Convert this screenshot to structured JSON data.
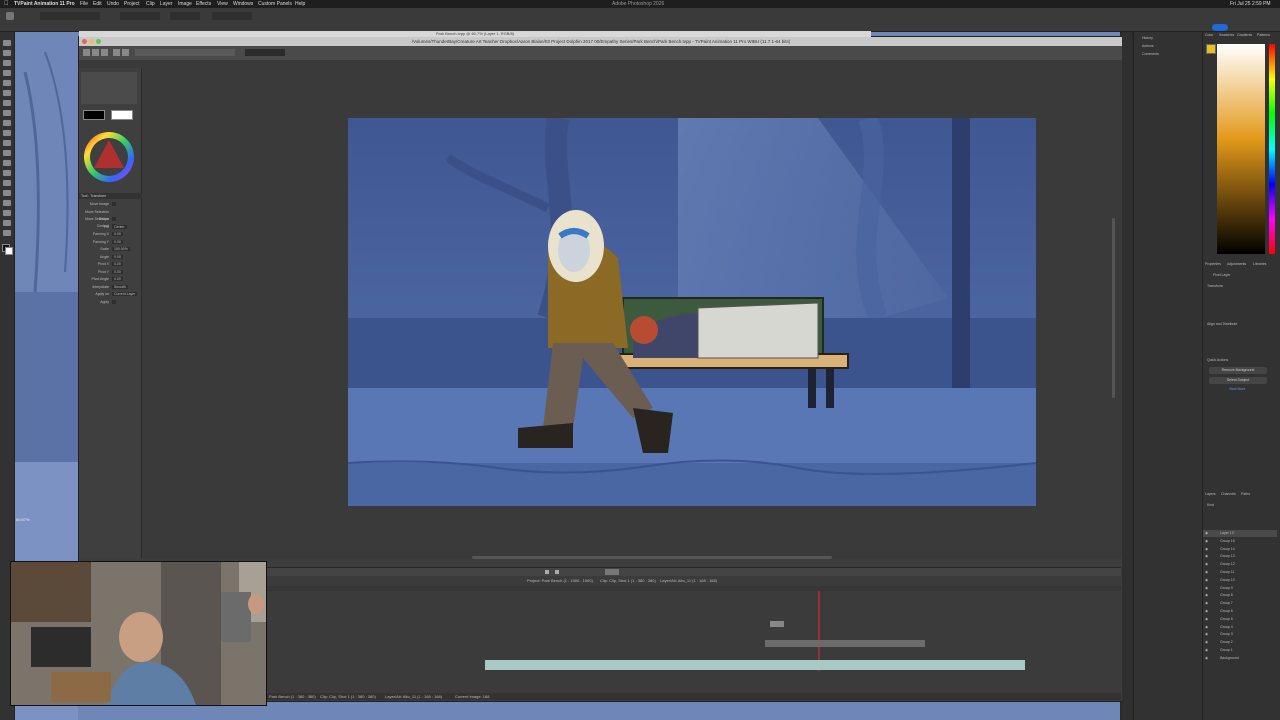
{
  "menubar": {
    "app_name": "TVPaint Animation 11 Pro",
    "items": [
      "File",
      "Edit",
      "Undo",
      "Project",
      "Clip",
      "Layer",
      "Image",
      "Effects",
      "View",
      "Windows",
      "Custom Panels",
      "Help"
    ],
    "center_title": "Adobe Photoshop 2026",
    "clock": "Fri Jul 25 2:59 PM"
  },
  "tvpaint": {
    "doc_tab": "Park Bench.tvpp @ 60.7% (Layer 1, RGB/8)",
    "window_path": "/Volumes/ThunderBay/Creature Art Teacher Dropbox/Aaron Blaise/03 Project Dolphin 2017 00/Empathy Series/Park Bench/Park Bench.tvpp - TVPaint Animation 11 Pro WIBU (11.7.1-64 bits)",
    "zoom_readout": "60.7%",
    "left_panel": {
      "swatch_labels": [
        "Primary",
        "Secondary"
      ],
      "tool_title": "Tool : Transform",
      "props": [
        {
          "label": "Move Image",
          "value": ""
        },
        {
          "label": "Move Selection Shape",
          "value": ""
        },
        {
          "label": "Move Selection Content",
          "value": ""
        },
        {
          "label": "Pin",
          "value": "Center"
        },
        {
          "label": "Panning X",
          "value": "0.00"
        },
        {
          "label": "Panning Y",
          "value": "0.00"
        },
        {
          "label": "Scale",
          "value": "100.00%"
        },
        {
          "label": "Angle",
          "value": "0.00"
        },
        {
          "label": "Pivot X",
          "value": "0.00"
        },
        {
          "label": "Pivot Y",
          "value": "0.00"
        },
        {
          "label": "Pivot Angle",
          "value": "0.00"
        },
        {
          "label": "Interpolate",
          "value": "Smooth"
        },
        {
          "label": "Apply on",
          "value": "Current Layer"
        },
        {
          "label": "Apply",
          "value": ""
        }
      ]
    },
    "timeline": {
      "header_labels": [
        "Project: Park Bench (1 : 1900 : 1900)",
        "Clip: Clip, Shot 1 (1 : 380 : 380)",
        "Layer/Alt: Alto_11 (1 : 168 : 168)"
      ],
      "footer_labels": [
        "Park Bench (1 : 380 : 380)",
        "Clip: Clip, Shot 1 (1 : 380 : 380)",
        "Layer/Alt: Alto_11 (1 : 168 : 168)",
        "Current Image: 168"
      ]
    }
  },
  "photoshop": {
    "right_panel_1": [
      "History",
      "Actions",
      "Comments"
    ],
    "color_tabs": [
      "Color",
      "Swatches",
      "Gradients",
      "Patterns"
    ],
    "properties": {
      "tabs": [
        "Properties",
        "Adjustments",
        "Libraries"
      ],
      "layer_type": "Pixel Layer",
      "section_transform": "Transform",
      "section_align": "Align and Distribute",
      "section_quick": "Quick Actions",
      "buttons": [
        "Remove Background",
        "Select Subject"
      ],
      "link": "View More"
    },
    "layers": {
      "tabs": [
        "Layers",
        "Channels",
        "Paths"
      ],
      "kind_filter": "Kind",
      "items": [
        "Layer 13",
        "Group 15",
        "Group 14",
        "Group 13",
        "Group 12",
        "Group 11",
        "Group 10",
        "Group 9",
        "Group 8",
        "Group 7",
        "Group 6",
        "Group 5",
        "Group 4",
        "Group 3",
        "Group 2",
        "Group 1",
        "Background"
      ]
    },
    "status_zoom": "60.67%"
  },
  "colors": {
    "scene_bg": "#4f6aa5",
    "accent": "#1f6bd6"
  }
}
